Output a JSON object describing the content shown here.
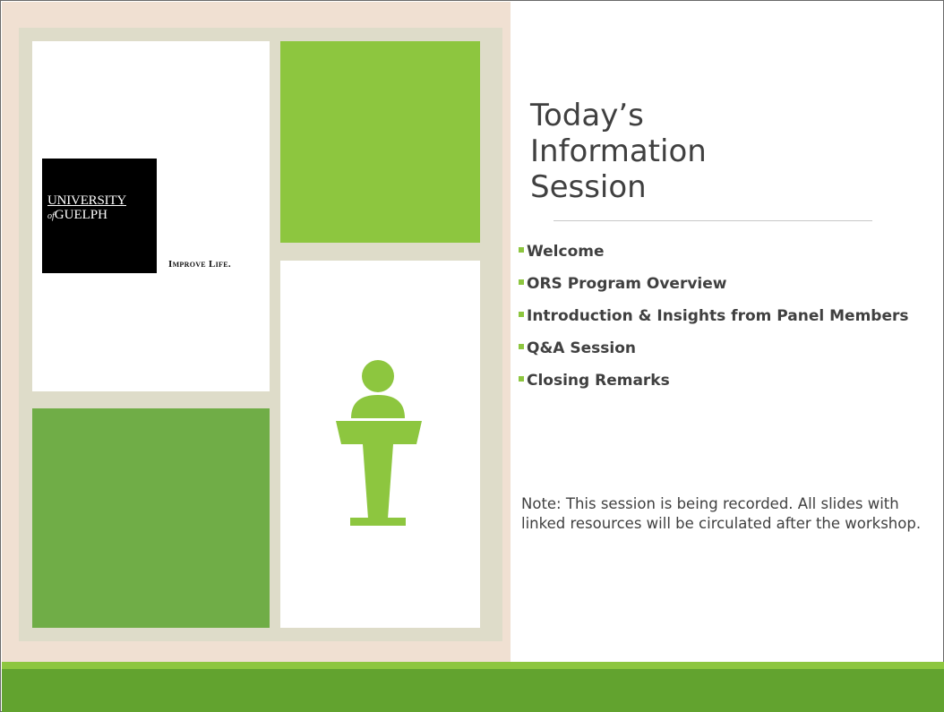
{
  "slide": {
    "title_lines": [
      "Today’s",
      "Information",
      "Session"
    ],
    "agenda": [
      "Welcome",
      "ORS Program Overview",
      "Introduction & Insights from Panel Members",
      "Q&A Session",
      "Closing Remarks"
    ],
    "note": "Note: This session is being recorded. All slides with linked resources will be circulated after the workshop."
  },
  "logo": {
    "line1": "UNIVERSITY",
    "line2_of": "of",
    "line2": "GUELPH",
    "tagline": "Improve Life."
  },
  "icons": {
    "speaker": "podium-speaker-icon"
  },
  "colors": {
    "accent_green": "#8dc63f",
    "dark_green": "#70ad47",
    "band_green": "#62a32f",
    "frame_beige": "#dedcc9",
    "peach_bg": "#f0e0d2",
    "text_gray": "#404040"
  }
}
